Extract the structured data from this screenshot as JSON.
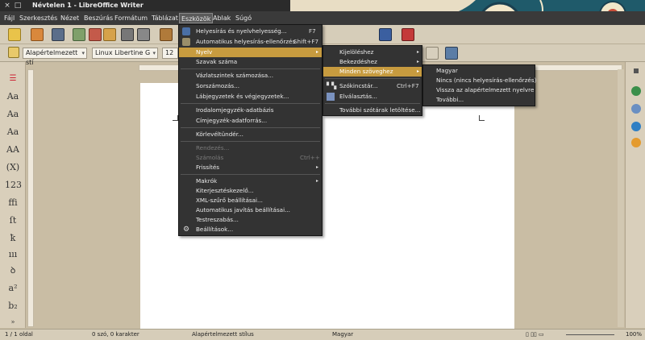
{
  "window": {
    "title": "Névtelen 1 - LibreOffice Writer"
  },
  "menubar": [
    "Fájl",
    "Szerkesztés",
    "Nézet",
    "Beszúrás",
    "Formátum",
    "Táblázat",
    "Eszközök",
    "Ablak",
    "Súgó"
  ],
  "toolbar": {
    "para_style": "Alapértelmezett stí",
    "font_name": "Linux Libertine G",
    "font_size": "12"
  },
  "left_sidebar": [
    "Aa",
    "Aa",
    "Aa",
    "AA",
    "(X)",
    "123",
    "ffi",
    "ſt",
    "ꝁ",
    "ııı",
    "ꝺ",
    "a²",
    "b₂",
    "»"
  ],
  "tools_menu": {
    "items": [
      {
        "label": "Helyesírás és nyelvhelyesség...",
        "shortcut": "F7",
        "icon": "spellcheck-icon"
      },
      {
        "label": "Automatikus helyesírás-ellenőrzés",
        "shortcut": "Shift+F7",
        "icon": "autospell-icon"
      },
      {
        "label": "Nyelv",
        "submenu": true
      },
      {
        "label": "Szavak száma"
      },
      {
        "label": "Vázlatszintek számozása..."
      },
      {
        "label": "Sorszámozás..."
      },
      {
        "label": "Lábjegyzetek és végjegyzetek..."
      },
      {
        "label": "Irodalomjegyzék-adatbázis"
      },
      {
        "label": "Címjegyzék-adatforrás..."
      },
      {
        "label": "Körlevéltündér..."
      },
      {
        "label": "Rendezés...",
        "disabled": true
      },
      {
        "label": "Számolás",
        "shortcut": "Ctrl++",
        "disabled": true
      },
      {
        "label": "Frissítés",
        "submenu": true
      },
      {
        "label": "Makrók",
        "submenu": true
      },
      {
        "label": "Kiterjesztéskezelő..."
      },
      {
        "label": "XML-szűrő beállításai..."
      },
      {
        "label": "Automatikus javítás beállításai..."
      },
      {
        "label": "Testreszabás..."
      },
      {
        "label": "Beállítások...",
        "icon": "gear-icon"
      }
    ]
  },
  "language_menu": {
    "items": [
      {
        "label": "Kijelöléshez",
        "submenu": true
      },
      {
        "label": "Bekezdéshez",
        "submenu": true
      },
      {
        "label": "Minden szöveghez",
        "submenu": true
      },
      {
        "label": "Szókincstár...",
        "shortcut": "Ctrl+F7",
        "icon": "thesaurus-icon"
      },
      {
        "label": "Elválasztás...",
        "icon": "hyphenation-icon"
      },
      {
        "label": "További szótárak letöltése..."
      }
    ]
  },
  "all_text_menu": {
    "items": [
      {
        "label": "Magyar"
      },
      {
        "label": "Nincs (nincs helyesírás-ellenőrzés)"
      },
      {
        "label": "Vissza az alapértelmezett nyelvre"
      },
      {
        "label": "További..."
      }
    ]
  },
  "statusbar": {
    "page": "1 / 1 oldal",
    "words": "0 szó, 0 karakter",
    "style": "Alapértelmezett stílus",
    "language": "Magyar",
    "zoom": "100%"
  },
  "colors": {
    "menu_bg": "#333333",
    "highlight": "#c79b3f",
    "app_bg": "#c9bda4"
  }
}
